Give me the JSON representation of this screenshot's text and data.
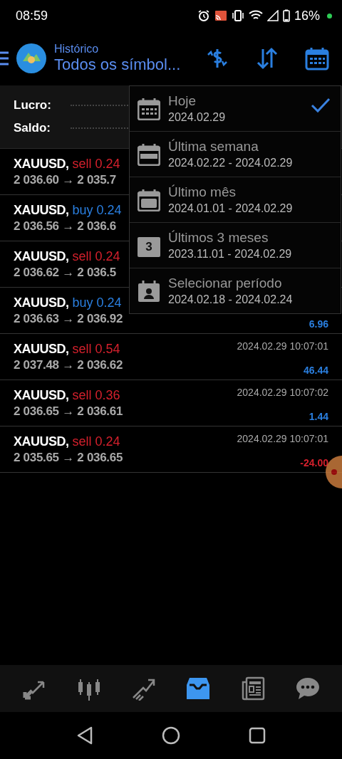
{
  "status_bar": {
    "time": "08:59",
    "battery": "16%"
  },
  "header": {
    "title": "Histórico",
    "subtitle": "Todos os símbol..."
  },
  "summary": [
    {
      "label": "Lucro:"
    },
    {
      "label": "Saldo:"
    }
  ],
  "trades": [
    {
      "symbol": "XAUUSD,",
      "side": "sell 0.24",
      "kind": "sell",
      "prices": "2 036.60 → 2 035.7"
    },
    {
      "symbol": "XAUUSD,",
      "side": "buy 0.24",
      "kind": "buy",
      "prices": "2 036.56 → 2 036.6"
    },
    {
      "symbol": "XAUUSD,",
      "side": "sell 0.24",
      "kind": "sell",
      "prices": "2 036.62 → 2 036.5"
    },
    {
      "symbol": "XAUUSD,",
      "side": "buy 0.24",
      "kind": "buy",
      "prices": "2 036.63 → 2 036.92",
      "profit": "6.96",
      "negative": false
    },
    {
      "symbol": "XAUUSD,",
      "side": "sell 0.54",
      "kind": "sell",
      "prices": "2 037.48 → 2 036.62",
      "time": "2024.02.29 10:07:01",
      "profit": "46.44",
      "negative": false
    },
    {
      "symbol": "XAUUSD,",
      "side": "sell 0.36",
      "kind": "sell",
      "prices": "2 036.65 → 2 036.61",
      "time": "2024.02.29 10:07:02",
      "profit": "1.44",
      "negative": false
    },
    {
      "symbol": "XAUUSD,",
      "side": "sell 0.24",
      "kind": "sell",
      "prices": "2 035.65 → 2 036.65",
      "time": "2024.02.29 10:07:01",
      "profit": "-24.00",
      "negative": true
    }
  ],
  "period_menu": [
    {
      "label": "Hoje",
      "range": "2024.02.29",
      "kind": "day",
      "selected": true
    },
    {
      "label": "Última semana",
      "range": "2024.02.22 - 2024.02.29",
      "kind": "week",
      "selected": false
    },
    {
      "label": "Último mês",
      "range": "2024.01.01 - 2024.02.29",
      "kind": "month",
      "selected": false
    },
    {
      "label": "Últimos 3 meses",
      "range": "2023.11.01 - 2024.02.29",
      "kind": "quarter",
      "icon_text": "3",
      "selected": false
    },
    {
      "label": "Selecionar período",
      "range": "2024.02.18 - 2024.02.24",
      "kind": "custom",
      "selected": false
    }
  ],
  "bottom_nav": [
    {
      "kind": "quotes",
      "selected": false
    },
    {
      "kind": "chart",
      "selected": false
    },
    {
      "kind": "trade",
      "selected": false
    },
    {
      "kind": "history",
      "selected": true
    },
    {
      "kind": "news",
      "selected": false
    },
    {
      "kind": "chat",
      "selected": false
    }
  ]
}
